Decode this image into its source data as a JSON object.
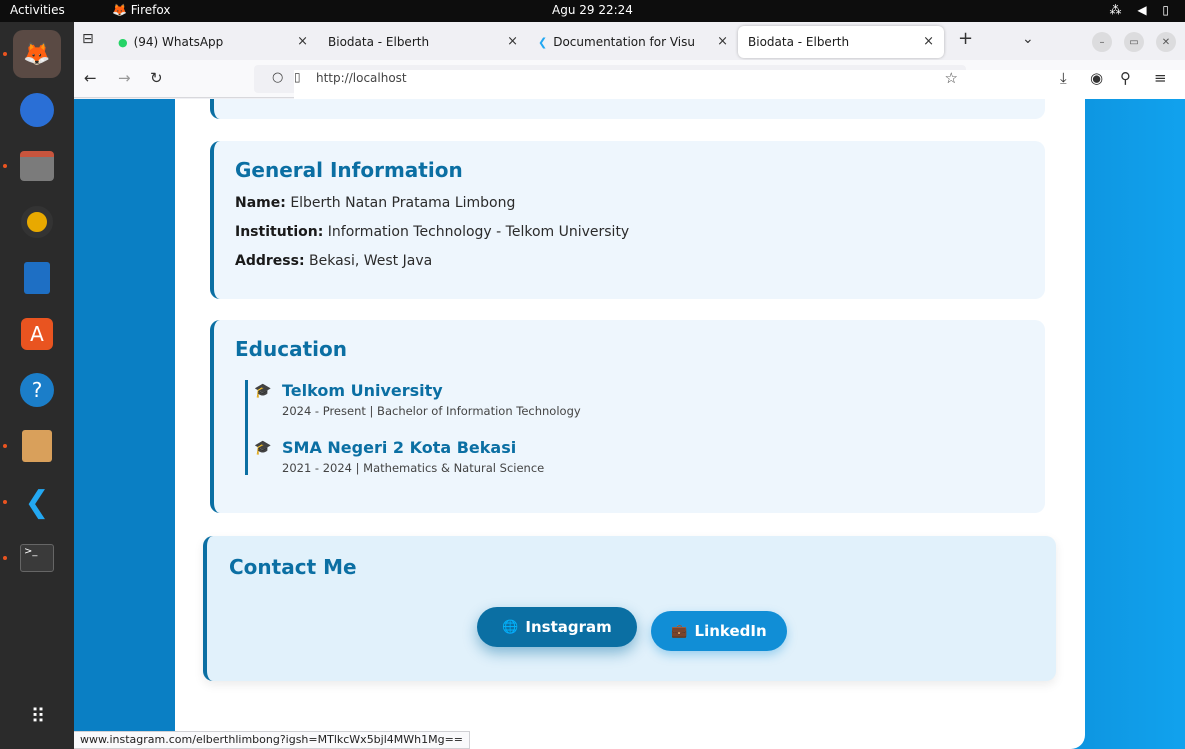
{
  "topbar": {
    "activities": "Activities",
    "app_name": "Firefox",
    "clock": "Agu 29  22:24",
    "tray": "⁂ ◀ ▯"
  },
  "browser": {
    "tabs": [
      {
        "label": "(94) WhatsApp",
        "icon": "whatsapp-icon"
      },
      {
        "label": "Biodata - Elberth",
        "icon": ""
      },
      {
        "label": "Documentation for Visu",
        "icon": "vscode-icon"
      },
      {
        "label": "Biodata - Elberth",
        "icon": ""
      }
    ],
    "url": "http://localhost",
    "status_url": "www.instagram.com/elberthlimbong?igsh=MTlkcWx5bjl4MWh1Mg=="
  },
  "page": {
    "general": {
      "title": "General Information",
      "name_label": "Name:",
      "name_value": "Elberth Natan Pratama Limbong",
      "institution_label": "Institution:",
      "institution_value": "Information Technology - Telkom University",
      "address_label": "Address:",
      "address_value": "Bekasi, West Java"
    },
    "education": {
      "title": "Education",
      "items": [
        {
          "school": "Telkom University",
          "detail": "2024 - Present | Bachelor of Information Technology"
        },
        {
          "school": "SMA Negeri 2 Kota Bekasi",
          "detail": "2021 - 2024 | Mathematics & Natural Science"
        }
      ]
    },
    "contact": {
      "title": "Contact Me",
      "instagram_label": "Instagram",
      "linkedin_label": "LinkedIn"
    }
  },
  "colors": {
    "accent": "#0b6fa3",
    "card_bg": "#eef6fd",
    "viewport_bg": "#0e95e0"
  }
}
